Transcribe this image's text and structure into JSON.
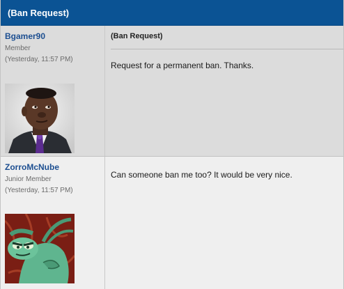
{
  "thread": {
    "title": "(Ban Request)"
  },
  "posts": [
    {
      "username": "Bgamer90",
      "rank": "Member",
      "timestamp": "(Yesterday, 11:57 PM)",
      "avatar_icon": "man-in-suit-avatar",
      "title": "(Ban Request)",
      "body": "Request for a permanent ban. Thanks."
    },
    {
      "username": "ZorroMcNube",
      "rank": "Junior Member",
      "timestamp": "(Yesterday, 11:57 PM)",
      "avatar_icon": "cartoon-mantis-avatar",
      "body": "Can someone ban me too? It would be very nice."
    }
  ],
  "colors": {
    "header_bg": "#0b5394",
    "username": "#1d4f91",
    "post1_bg": "#dcdcdc",
    "post2_bg": "#efefef"
  }
}
